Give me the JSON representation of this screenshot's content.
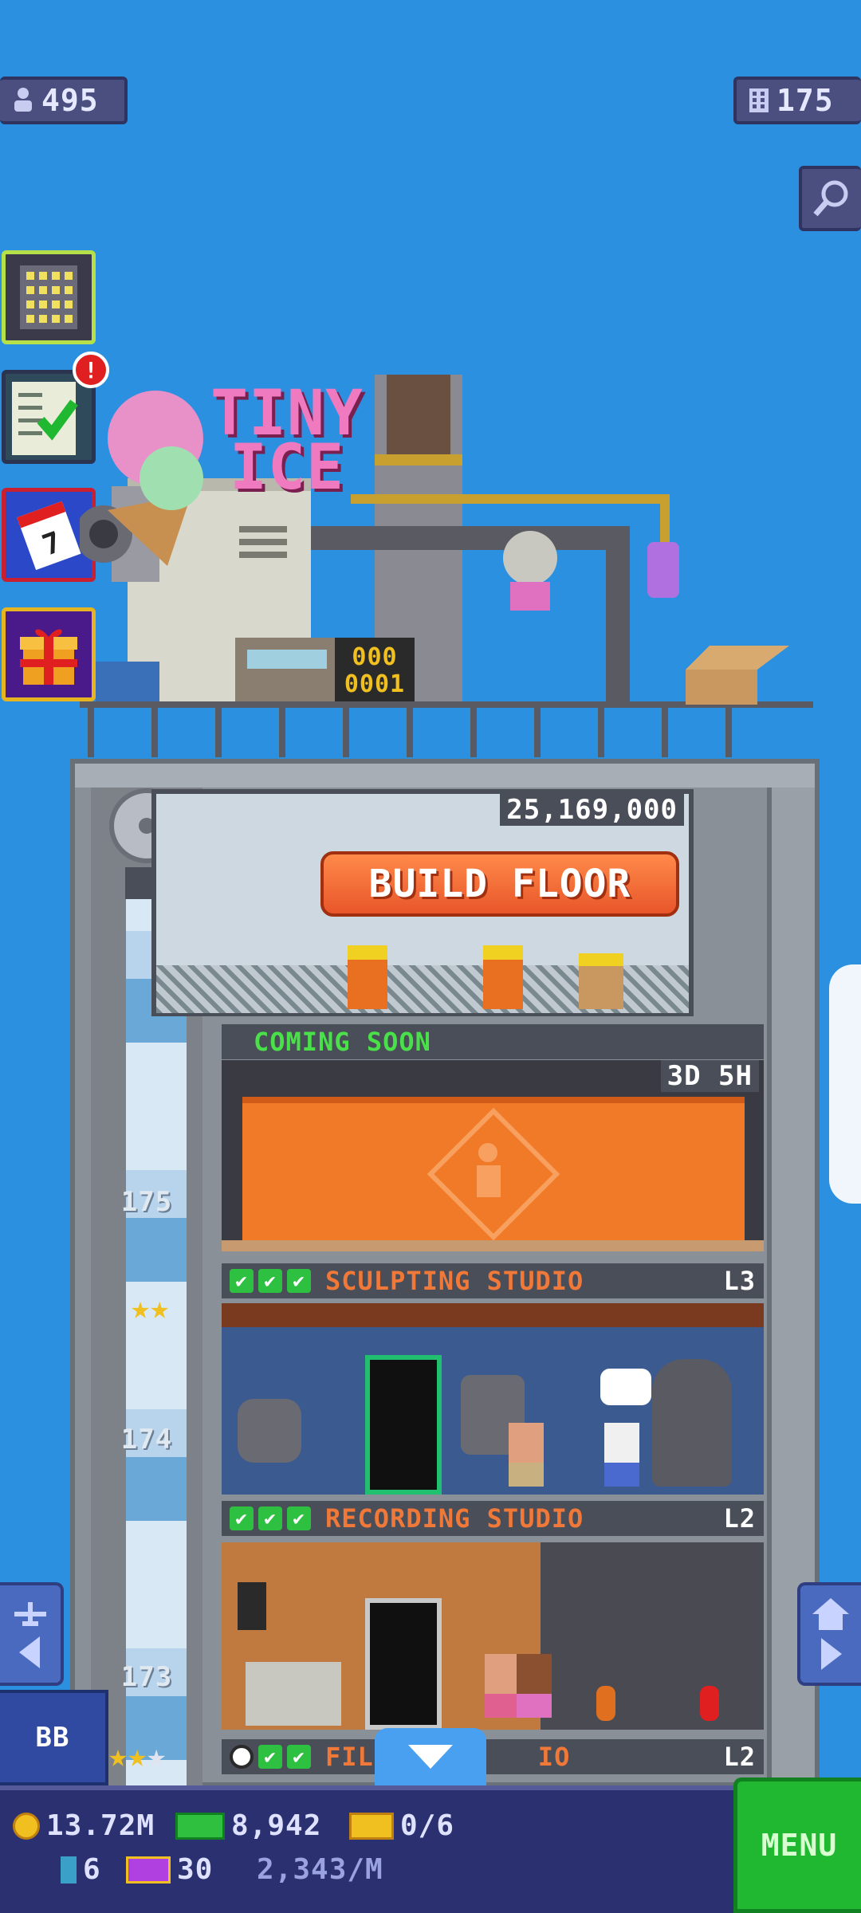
{
  "hud": {
    "population": "495",
    "floors": "175"
  },
  "icons": {
    "population": "person-icon",
    "floors": "building-icon",
    "search": "magnifier-icon",
    "tower": "tower-icon",
    "missions": "checklist-icon",
    "calendar": "calendar-icon",
    "gift": "gift-icon",
    "notification": "!"
  },
  "rooftop": {
    "sign_line1": "TINY",
    "sign_line2": "ICE",
    "counter_top": "000",
    "counter_bottom": "0001"
  },
  "build": {
    "cost": "25,169,000",
    "label": "BUILD FLOOR"
  },
  "coming_soon": {
    "label": "COMING SOON",
    "timer": "3D 5H"
  },
  "floors": [
    {
      "number": "175",
      "name": "SCULPTING STUDIO",
      "level": "L3",
      "checks": 3
    },
    {
      "number": "174",
      "name": "RECORDING STUDIO",
      "level": "L2",
      "checks": 3
    },
    {
      "number": "173",
      "name": "FIL",
      "name_tail": "IO",
      "level": "L2",
      "checks": 2
    }
  ],
  "bottom": {
    "coins": "13.72M",
    "bux": "8,942",
    "tickets": "0/6",
    "gems": "6",
    "vip": "30",
    "rate": "2,343/M",
    "menu": "MENU",
    "bb": "BB"
  },
  "colors": {
    "sky": "#2b90e0",
    "build_button": "#e8562a",
    "menu_button": "#20b830",
    "coming_soon_text": "#4ae04a",
    "floor_name_text": "#f07838"
  }
}
